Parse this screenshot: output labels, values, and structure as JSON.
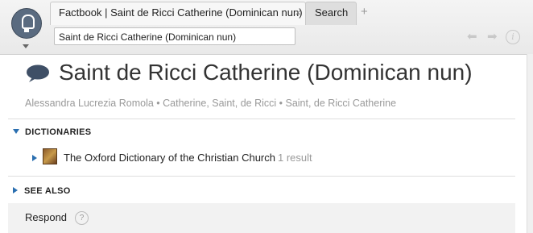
{
  "tabs": {
    "active_label": "Factbook | Saint de Ricci Catherine (Dominican nun)",
    "close_glyph": "×",
    "search_label": "Search",
    "new_tab_glyph": "+"
  },
  "address": {
    "value": "Saint de Ricci Catherine (Dominican nun)"
  },
  "nav": {
    "back_glyph": "⬅",
    "forward_glyph": "➡",
    "info_glyph": "i"
  },
  "page": {
    "title": "Saint de Ricci Catherine (Dominican nun)",
    "aliases": "Alessandra Lucrezia Romola • Catherine, Saint, de Ricci • Saint, de Ricci Catherine"
  },
  "dictionaries": {
    "heading": "DICTIONARIES",
    "items": [
      {
        "title": "The Oxford Dictionary of the Christian Church",
        "count": "1 result"
      }
    ]
  },
  "see_also": {
    "heading": "SEE ALSO"
  },
  "respond": {
    "label": "Respond",
    "help_glyph": "?"
  },
  "colors": {
    "accent": "#2a6fb0",
    "icon_bg": "#5a6b80"
  },
  "icons": [
    "lightbulb-icon",
    "speech-bubble-icon",
    "book-icon",
    "back-arrow-icon",
    "forward-arrow-icon",
    "info-icon",
    "help-icon"
  ]
}
